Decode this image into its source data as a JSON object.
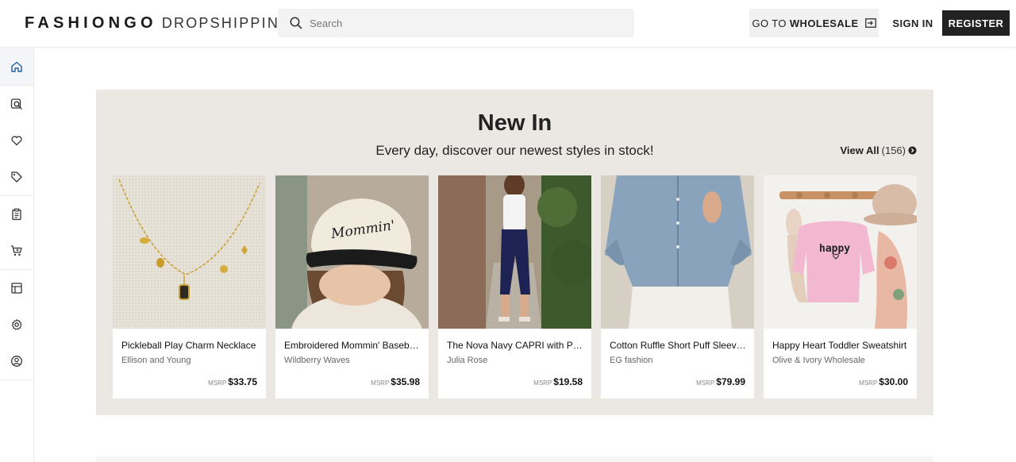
{
  "header": {
    "logo_main": "FASHIONGO",
    "logo_sub": "DROPSHIPPING",
    "search_placeholder": "Search",
    "wholesale_prefix": "GO TO",
    "wholesale_bold": "WHOLESALE",
    "signin_label": "SIGN IN",
    "register_label": "REGISTER"
  },
  "sidebar": {
    "items": [
      {
        "icon": "home-icon",
        "active": true
      },
      {
        "icon": "search-product-icon",
        "active": false
      },
      {
        "icon": "heart-icon",
        "active": false
      },
      {
        "icon": "tag-icon",
        "active": false
      },
      {
        "icon": "clipboard-icon",
        "active": false
      },
      {
        "icon": "cart-icon",
        "active": false
      },
      {
        "icon": "layout-icon",
        "active": false
      },
      {
        "icon": "gear-icon",
        "active": false
      },
      {
        "icon": "user-circle-icon",
        "active": false
      }
    ]
  },
  "new_in": {
    "title": "New In",
    "subtitle": "Every day, discover our newest styles in stock!",
    "view_all_label": "View All",
    "view_all_count": "(156)",
    "msrp_label": "MSRP",
    "products": [
      {
        "name": "Pickleball Play Charm Necklace",
        "brand": "Ellison and Young",
        "price": "$33.75"
      },
      {
        "name": "Embroidered Mommin' Baseball Cap",
        "brand": "Wildberry Waves",
        "price": "$35.98"
      },
      {
        "name": "The Nova Navy CAPRI with Pockets",
        "brand": "Julia Rose",
        "price": "$19.58"
      },
      {
        "name": "Cotton Ruffle Short Puff Sleeve Top",
        "brand": "EG fashion",
        "price": "$79.99"
      },
      {
        "name": "Happy Heart Toddler Sweatshirt",
        "brand": "Olive & Ivory Wholesale",
        "price": "$30.00"
      }
    ],
    "image_texts": {
      "cap_text": "Mommin'",
      "sweatshirt_text": "happy"
    }
  },
  "colors": {
    "section_bg": "#ebe8e3",
    "register_bg": "#222222",
    "accent_blue": "#1f5fa8"
  }
}
